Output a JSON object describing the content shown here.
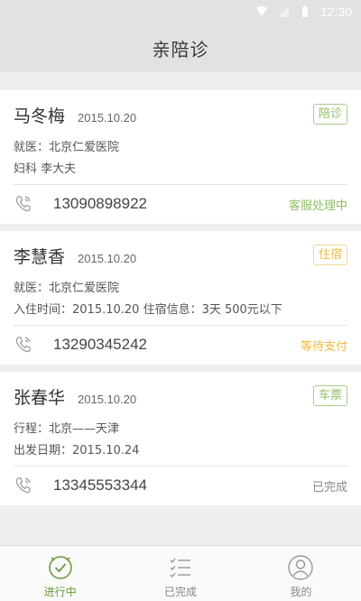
{
  "status_bar": {
    "time": "12:30"
  },
  "header": {
    "title": "亲陪诊"
  },
  "orders": [
    {
      "name": "马冬梅",
      "date": "2015.10.20",
      "tag": "陪诊",
      "tag_color": "#8fbf63",
      "line1": "就医：北京仁爱医院",
      "line2": "妇科    李大夫",
      "phone": "13090898922",
      "status": "客服处理中",
      "status_color": "#8fbf63"
    },
    {
      "name": "李慧香",
      "date": "2015.10.20",
      "tag": "住宿",
      "tag_color": "#f0b93d",
      "line1": "就医：北京仁爱医院",
      "line2": "入住时间：2015.10.20    住宿信息：3天    500元以下",
      "phone": "13290345242",
      "status": "等待支付",
      "status_color": "#f0b93d"
    },
    {
      "name": "张春华",
      "date": "2015.10.20",
      "tag": "车票",
      "tag_color": "#8fbf63",
      "line1": "行程：北京——天津",
      "line2": "出发日期：2015.10.24",
      "phone": "13345553344",
      "status": "已完成",
      "status_color": "#888888"
    }
  ],
  "tabbar": {
    "tabs": [
      {
        "label": "进行中",
        "icon": "clock-check-icon",
        "active": true
      },
      {
        "label": "已完成",
        "icon": "checklist-icon",
        "active": false
      },
      {
        "label": "我的",
        "icon": "user-icon",
        "active": false
      }
    ]
  }
}
